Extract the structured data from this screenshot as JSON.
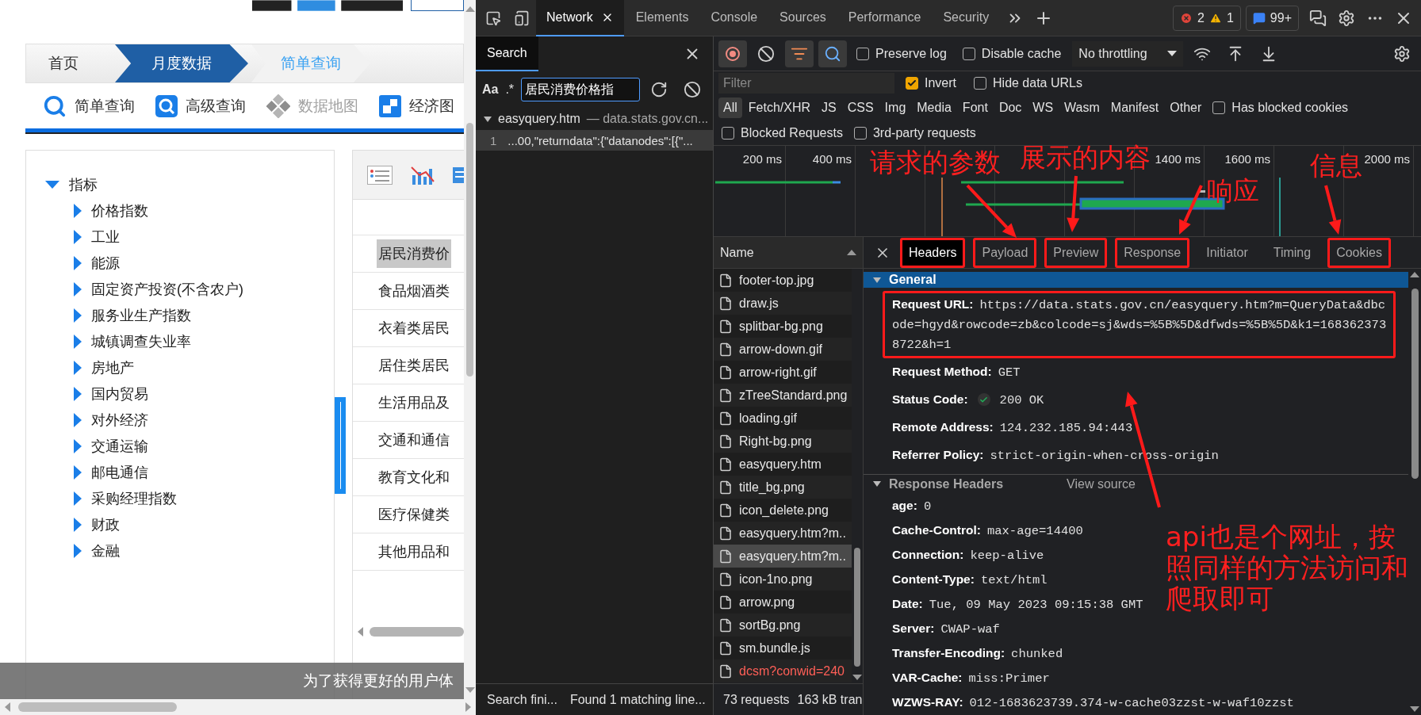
{
  "page": {
    "breadcrumb": [
      {
        "label": "首页",
        "kind": "home"
      },
      {
        "label": "月度数据",
        "kind": "section"
      },
      {
        "label": "简单查询",
        "kind": "current"
      }
    ],
    "tools": [
      {
        "label": "简单查询",
        "kind": "search",
        "disabled": false
      },
      {
        "label": "高级查询",
        "kind": "advanced",
        "disabled": false
      },
      {
        "label": "数据地图",
        "kind": "map",
        "disabled": true
      },
      {
        "label": "经济图",
        "kind": "chart",
        "disabled": false
      }
    ],
    "tree": {
      "label": "指标",
      "expanded": true,
      "children": [
        {
          "label": "价格指数",
          "expanded": false
        },
        {
          "label": "工业",
          "expanded": false
        },
        {
          "label": "能源",
          "expanded": false
        },
        {
          "label": "固定资产投资(不含农户)",
          "expanded": false
        },
        {
          "label": "服务业生产指数",
          "expanded": false
        },
        {
          "label": "城镇调查失业率",
          "expanded": false
        },
        {
          "label": "房地产",
          "expanded": false
        },
        {
          "label": "国内贸易",
          "expanded": false
        },
        {
          "label": "对外经济",
          "expanded": false
        },
        {
          "label": "交通运输",
          "expanded": false
        },
        {
          "label": "邮电通信",
          "expanded": false
        },
        {
          "label": "采购经理指数",
          "expanded": false
        },
        {
          "label": "财政",
          "expanded": false
        },
        {
          "label": "金融",
          "expanded": false
        }
      ]
    },
    "table_rows": [
      {
        "label": "居民消费价",
        "selected": true
      },
      {
        "label": "食品烟酒类",
        "selected": false
      },
      {
        "label": "衣着类居民",
        "selected": false
      },
      {
        "label": "居住类居民",
        "selected": false
      },
      {
        "label": "生活用品及",
        "selected": false
      },
      {
        "label": "交通和通信",
        "selected": false
      },
      {
        "label": "教育文化和",
        "selected": false
      },
      {
        "label": "医疗保健类",
        "selected": false
      },
      {
        "label": "其他用品和",
        "selected": false
      }
    ],
    "banner": "为了获得更好的用户体"
  },
  "devtools": {
    "tabs": [
      {
        "label": "Network",
        "selected": true
      },
      {
        "label": "Elements",
        "selected": false
      },
      {
        "label": "Console",
        "selected": false
      },
      {
        "label": "Sources",
        "selected": false
      },
      {
        "label": "Performance",
        "selected": false
      },
      {
        "label": "Security",
        "selected": false
      }
    ],
    "errors": "2",
    "warnings": "1",
    "issues": "99+",
    "search": {
      "title": "Search",
      "match_case_label": "Aa",
      "regex_label": ".*",
      "query": "居民消费价格指",
      "result_file": "easyquery.htm",
      "result_host": "— data.stats.gov.cn...",
      "expanded": true,
      "match_line": "1",
      "match_text": "...00,\"returndata\":{\"datanodes\":[{\"...",
      "status": "Search fini...",
      "found": "Found 1 matching line..."
    },
    "recording": true,
    "toolbar_options": [
      {
        "label": "Preserve log",
        "checked": false
      },
      {
        "label": "Disable cache",
        "checked": false
      }
    ],
    "throttling": "No throttling",
    "filter_placeholder": "Filter",
    "filter_options": [
      {
        "label": "Invert",
        "checked": true
      },
      {
        "label": "Hide data URLs",
        "checked": false
      }
    ],
    "types": [
      {
        "label": "All",
        "selected": true
      },
      {
        "label": "Fetch/XHR",
        "selected": false
      },
      {
        "label": "JS",
        "selected": false
      },
      {
        "label": "CSS",
        "selected": false
      },
      {
        "label": "Img",
        "selected": false
      },
      {
        "label": "Media",
        "selected": false
      },
      {
        "label": "Font",
        "selected": false
      },
      {
        "label": "Doc",
        "selected": false
      },
      {
        "label": "WS",
        "selected": false
      },
      {
        "label": "Wasm",
        "selected": false
      },
      {
        "label": "Manifest",
        "selected": false
      },
      {
        "label": "Other",
        "selected": false
      }
    ],
    "type_options": [
      {
        "label": "Has blocked cookies",
        "checked": false
      }
    ],
    "extra_options": [
      {
        "label": "Blocked Requests",
        "checked": false
      },
      {
        "label": "3rd-party requests",
        "checked": false
      }
    ],
    "timeline_ticks": [
      "200 ms",
      "400 ms",
      "1400 ms",
      "1600 ms",
      "2000 ms"
    ],
    "name_header": "Name",
    "requests": [
      {
        "name": "footer-top.jpg",
        "selected": false,
        "failed": false
      },
      {
        "name": "draw.js",
        "selected": false,
        "failed": false
      },
      {
        "name": "splitbar-bg.png",
        "selected": false,
        "failed": false
      },
      {
        "name": "arrow-down.gif",
        "selected": false,
        "failed": false
      },
      {
        "name": "arrow-right.gif",
        "selected": false,
        "failed": false
      },
      {
        "name": "zTreeStandard.png",
        "selected": false,
        "failed": false
      },
      {
        "name": "loading.gif",
        "selected": false,
        "failed": false
      },
      {
        "name": "Right-bg.png",
        "selected": false,
        "failed": false
      },
      {
        "name": "easyquery.htm",
        "selected": false,
        "failed": false
      },
      {
        "name": "title_bg.png",
        "selected": false,
        "failed": false
      },
      {
        "name": "icon_delete.png",
        "selected": false,
        "failed": false
      },
      {
        "name": "easyquery.htm?m..",
        "selected": false,
        "failed": false
      },
      {
        "name": "easyquery.htm?m..",
        "selected": true,
        "failed": false
      },
      {
        "name": "icon-1no.png",
        "selected": false,
        "failed": false
      },
      {
        "name": "arrow.png",
        "selected": false,
        "failed": false
      },
      {
        "name": "sortBg.png",
        "selected": false,
        "failed": false
      },
      {
        "name": "sm.bundle.js",
        "selected": false,
        "failed": false
      },
      {
        "name": "dcsm?conwid=240",
        "selected": false,
        "failed": true
      }
    ],
    "summary": [
      "73 requests",
      "163 kB tran"
    ],
    "detail_tabs": [
      {
        "label": "Headers",
        "selected": true,
        "highlighted": true
      },
      {
        "label": "Payload",
        "selected": false,
        "highlighted": true
      },
      {
        "label": "Preview",
        "selected": false,
        "highlighted": true
      },
      {
        "label": "Response",
        "selected": false,
        "highlighted": true
      },
      {
        "label": "Initiator",
        "selected": false,
        "highlighted": false
      },
      {
        "label": "Timing",
        "selected": false,
        "highlighted": false
      },
      {
        "label": "Cookies",
        "selected": false,
        "highlighted": true
      }
    ],
    "general": {
      "title": "General",
      "expanded": true,
      "rows": [
        {
          "label": "Request URL:",
          "value": "https://data.stats.gov.cn/easyquery.htm?m=QueryData&dbcode=hgyd&rowcode=zb&colcode=sj&wds=%5B%5D&dfwds=%5B%5D&k1=1683623738722&h=1",
          "kind": "text",
          "highlighted": true
        },
        {
          "label": "Request Method:",
          "value": "GET",
          "kind": "text",
          "highlighted": false
        },
        {
          "label": "Status Code:",
          "value": "200 OK",
          "kind": "status",
          "highlighted": false
        },
        {
          "label": "Remote Address:",
          "value": "124.232.185.94:443",
          "kind": "text",
          "highlighted": false
        },
        {
          "label": "Referrer Policy:",
          "value": "strict-origin-when-cross-origin",
          "kind": "text",
          "highlighted": false
        }
      ]
    },
    "response_headers": {
      "title": "Response Headers",
      "action": "View source",
      "expanded": true,
      "rows": [
        {
          "label": "age:",
          "value": "0"
        },
        {
          "label": "Cache-Control:",
          "value": "max-age=14400"
        },
        {
          "label": "Connection:",
          "value": "keep-alive"
        },
        {
          "label": "Content-Type:",
          "value": "text/html"
        },
        {
          "label": "Date:",
          "value": "Tue, 09 May 2023 09:15:38 GMT"
        },
        {
          "label": "Server:",
          "value": "CWAP-waf"
        },
        {
          "label": "Transfer-Encoding:",
          "value": "chunked"
        },
        {
          "label": "VAR-Cache:",
          "value": "miss:Primer"
        },
        {
          "label": "WZWS-RAY:",
          "value": "012-1683623739.374-w-cache03zzst-w-waf10zzst"
        }
      ]
    }
  },
  "annotations": [
    {
      "text": "请求的参数"
    },
    {
      "text": "展示的内容"
    },
    {
      "text": "响应"
    },
    {
      "text": "信息"
    },
    {
      "text": "api也是个网址，按照同样的方法访问和爬取即可"
    }
  ]
}
